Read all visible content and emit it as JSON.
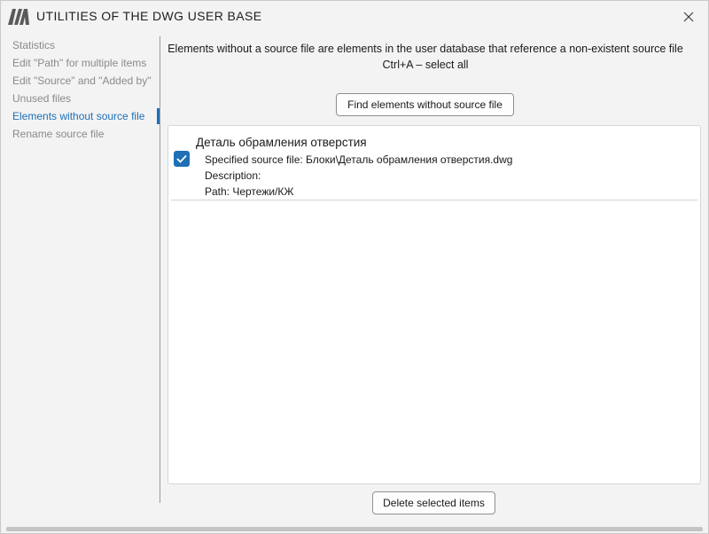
{
  "window": {
    "title": "UTILITIES OF THE DWG USER BASE",
    "logo_icon": "nanocad-logo-icon",
    "close_icon": "close-icon"
  },
  "sidebar": {
    "items": [
      {
        "label": "Statistics",
        "active": false
      },
      {
        "label": "Edit \"Path\" for multiple items",
        "active": false
      },
      {
        "label": "Edit \"Source\" and \"Added by\"",
        "active": false
      },
      {
        "label": "Unused files",
        "active": false
      },
      {
        "label": "Elements without source file",
        "active": true
      },
      {
        "label": "Rename source file",
        "active": false
      }
    ]
  },
  "main": {
    "description_line1": "Elements without a source file are elements in the user database that reference a non-existent source file",
    "description_line2": "Ctrl+A – select all",
    "find_button_label": "Find elements without source file",
    "delete_button_label": "Delete selected items",
    "items": [
      {
        "name": "Деталь обрамления отверстия",
        "checked": true,
        "source_file": "Specified source file: Блоки\\Деталь обрамления отверстия.dwg",
        "description": "Description:",
        "path": "Path: Чертежи/КЖ"
      }
    ]
  },
  "colors": {
    "accent": "#1f6fb5",
    "inactive_text": "#8a8a8a",
    "background": "#f3f3f3"
  }
}
